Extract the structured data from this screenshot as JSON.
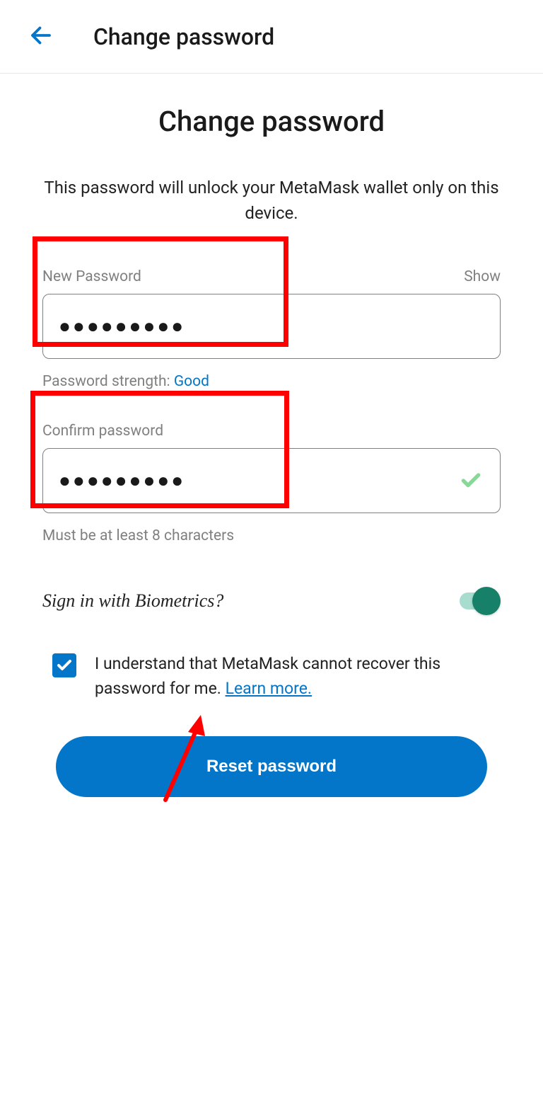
{
  "header": {
    "title": "Change password"
  },
  "main": {
    "title": "Change password",
    "subtitle": "This password will unlock your MetaMask wallet only on this device."
  },
  "form": {
    "newPassword": {
      "label": "New Password",
      "value": "●●●●●●●●●",
      "showLabel": "Show"
    },
    "strength": {
      "label": "Password strength: ",
      "value": "Good"
    },
    "confirmPassword": {
      "label": "Confirm password",
      "value": "●●●●●●●●●"
    },
    "confirmHint": "Must be at least 8 characters"
  },
  "biometrics": {
    "label": "Sign in with Biometrics?"
  },
  "disclaimer": {
    "text": "I understand that MetaMask cannot recover this password for me. ",
    "learnMore": "Learn more."
  },
  "resetButton": {
    "label": "Reset password"
  }
}
